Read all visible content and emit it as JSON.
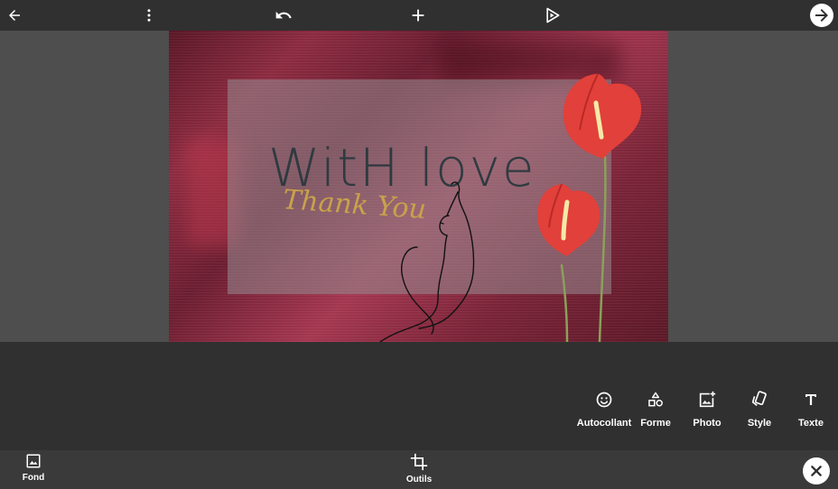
{
  "topbar": {
    "icons": [
      "back-arrow-icon",
      "more-vertical-icon",
      "undo-icon",
      "add-icon",
      "preview-play-icon",
      "next-arrow-icon"
    ]
  },
  "canvas": {
    "headline": "WitH love",
    "script_text": "Thank You",
    "colors": {
      "background": "#8e2a40",
      "card": "#968c91",
      "headline": "#2f3a40",
      "script": "#c9a24a",
      "flower": "#e2403a"
    }
  },
  "tools": [
    {
      "label": "Autocollant",
      "icon": "sticker-smiley-icon"
    },
    {
      "label": "Forme",
      "icon": "shapes-icon"
    },
    {
      "label": "Photo",
      "icon": "add-photo-icon"
    },
    {
      "label": "Style",
      "icon": "style-cards-icon"
    },
    {
      "label": "Texte",
      "icon": "text-icon"
    }
  ],
  "bottombar": {
    "fond_label": "Fond",
    "outils_label": "Outils",
    "icons": [
      "image-icon",
      "crop-icon",
      "close-icon"
    ]
  }
}
